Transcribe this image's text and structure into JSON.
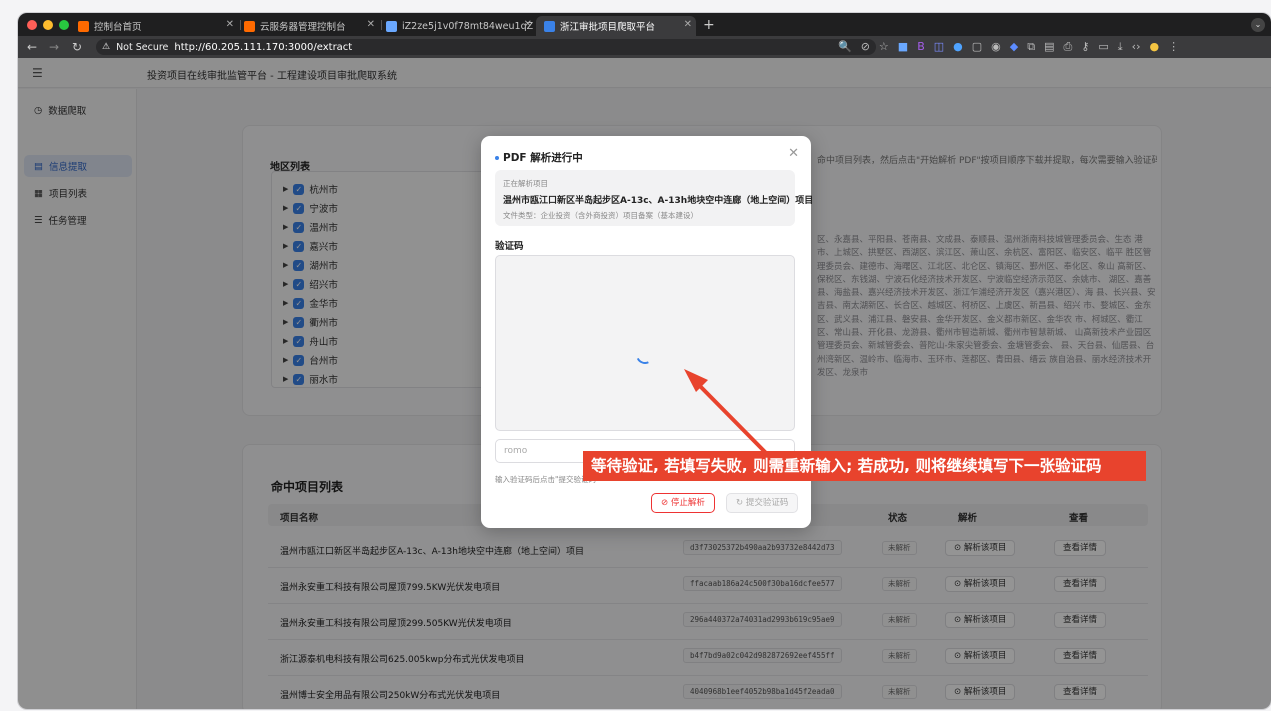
{
  "browser": {
    "tabs": [
      {
        "label": "控制台首页",
        "icon": "console-icon",
        "color": "#ff6a00"
      },
      {
        "label": "云服务器管理控制台",
        "icon": "console-icon",
        "color": "#ff6a00"
      },
      {
        "label": "iZ2ze5j1v0f78mt84weu1qZ -",
        "icon": "terminal-icon",
        "color": "#6aa8ff"
      },
      {
        "label": "浙江审批项目爬取平台",
        "icon": "app-icon",
        "color": "#3a82e8"
      }
    ],
    "not_secure": "Not Secure",
    "url": "http://60.205.111.170:3000/extract"
  },
  "app": {
    "header_title": "投资项目在线审批监管平台 - 工程建设项目审批爬取系统",
    "sidebar": [
      {
        "label": "数据爬取",
        "icon": "clock-icon",
        "active": false
      },
      {
        "label": "信息提取",
        "icon": "doc-icon",
        "active": true
      },
      {
        "label": "项目列表",
        "icon": "table-icon",
        "active": false
      },
      {
        "label": "任务管理",
        "icon": "list-icon",
        "active": false
      }
    ]
  },
  "regions": {
    "title": "地区列表",
    "items": [
      "杭州市",
      "宁波市",
      "温州市",
      "嘉兴市",
      "湖州市",
      "绍兴市",
      "金华市",
      "衢州市",
      "舟山市",
      "台州市",
      "丽水市"
    ],
    "hint": "命中项目列表，然后点击\"开始解析 PDF\"按项目顺序下载并提取，每次需要输入验证码",
    "districts": "区、永嘉县、平阳县、苍南县、文成县、泰顺县、温州浙南科技城管理委员会、生态 港市、上城区、拱墅区、西湖区、滨江区、萧山区、余杭区、富阳区、临安区、临平 胜区管理委员会、建德市、海曙区、江北区、北仑区、镇海区、鄞州区、奉化区、象山 高新区、保税区、东钱湖、宁波石化经济技术开发区、宁波临空经济示范区、余姚市、 湖区、嘉善县、海盐县、嘉兴经济技术开发区、浙江乍浦经济开发区（嘉兴港区）、海 县、长兴县、安吉县、南太湖新区、长合区、越城区、柯桥区、上虞区、新昌县、绍兴 市、婺城区、金东区、武义县、浦江县、磐安县、金华开发区、金义都市新区、金华农 市、柯城区、衢江区、常山县、开化县、龙游县、衢州市智造新城、衢州市智慧新城、 山高新技术产业园区管理委员会、新城管委会、普陀山-朱家尖管委会、金塘管委会、 县、天台县、仙居县、台州湾新区、温岭市、临海市、玉环市、莲都区、青田县、缙云 族自治县、丽水经济技术开发区、龙泉市"
  },
  "hits": {
    "title": "命中项目列表",
    "columns": [
      "项目名称",
      "状态",
      "解析",
      "查看"
    ],
    "rows": [
      {
        "name": "温州市瓯江口新区半岛起步区A-13c、A-13h地块空中连廊（地上空间）项目",
        "hash": "d3f73025372b490aa2b93732e8442d73",
        "status": "未解析",
        "parse": "解析该项目",
        "view": "查看详情"
      },
      {
        "name": "温州永安重工科技有限公司屋顶799.5KW光伏发电项目",
        "hash": "ffacaab186a24c500f30ba16dcfee577",
        "status": "未解析",
        "parse": "解析该项目",
        "view": "查看详情"
      },
      {
        "name": "温州永安重工科技有限公司屋顶299.505KW光伏发电项目",
        "hash": "296a440372a74031ad2993b619c95ae9",
        "status": "未解析",
        "parse": "解析该项目",
        "view": "查看详情"
      },
      {
        "name": "浙江源泰机电科技有限公司625.005kwp分布式光伏发电项目",
        "hash": "b4f7bd9a02c042d982872692eef455ff",
        "status": "未解析",
        "parse": "解析该项目",
        "view": "查看详情"
      },
      {
        "name": "温州博士安全用品有限公司250kW分布式光伏发电项目",
        "hash": "4040968b1eef4052b98ba1d45f2eada0",
        "status": "未解析",
        "parse": "解析该项目",
        "view": "查看详情"
      }
    ]
  },
  "modal": {
    "title": "PDF 解析进行中",
    "current_label": "正在解析项目",
    "project_name": "温州市瓯江口新区半岛起步区A-13c、A-13h地块空中连廊（地上空间）项目",
    "file_type": "文件类型：企业投资（含外商投资）项目备案（基本建设）",
    "captcha_label": "验证码",
    "captcha_value": "romo",
    "hint": "输入验证码后点击\"提交验证码\"",
    "stop_label": "停止解析",
    "submit_label": "提交验证码"
  },
  "annotation": {
    "text": "等待验证, 若填写失败, 则需重新输入; 若成功, 则将继续填写下一张验证码",
    "color": "#e8432d"
  }
}
